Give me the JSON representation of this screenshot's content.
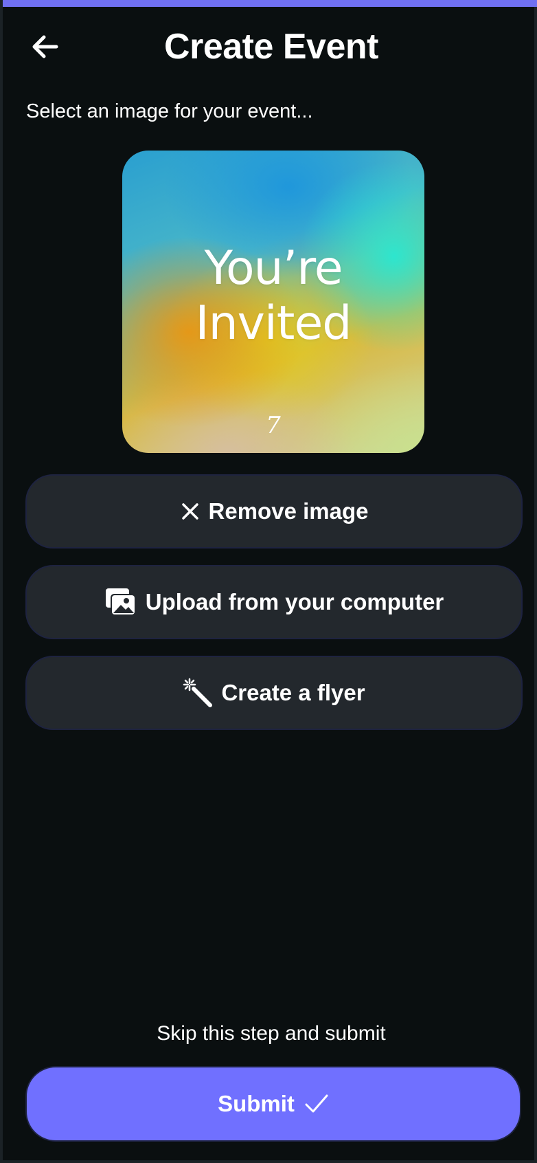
{
  "theme": {
    "accent": "#7070ff",
    "background": "#0a0f10",
    "button_background": "#23282d",
    "text": "#ffffff"
  },
  "header": {
    "back_icon": "arrow-left-icon",
    "title": "Create Event"
  },
  "subtitle": "Select an image for your event...",
  "event_image": {
    "line1": "You’re",
    "line2": "Invited",
    "mark": "7"
  },
  "actions": {
    "remove": {
      "label": "Remove image",
      "icon": "close-icon"
    },
    "upload": {
      "label": "Upload from your computer",
      "icon": "images-icon"
    },
    "flyer": {
      "label": "Create a flyer",
      "icon": "magic-wand-icon"
    }
  },
  "footer": {
    "skip_label": "Skip this step and submit",
    "submit_label": "Submit",
    "submit_icon": "checkmark-icon"
  }
}
